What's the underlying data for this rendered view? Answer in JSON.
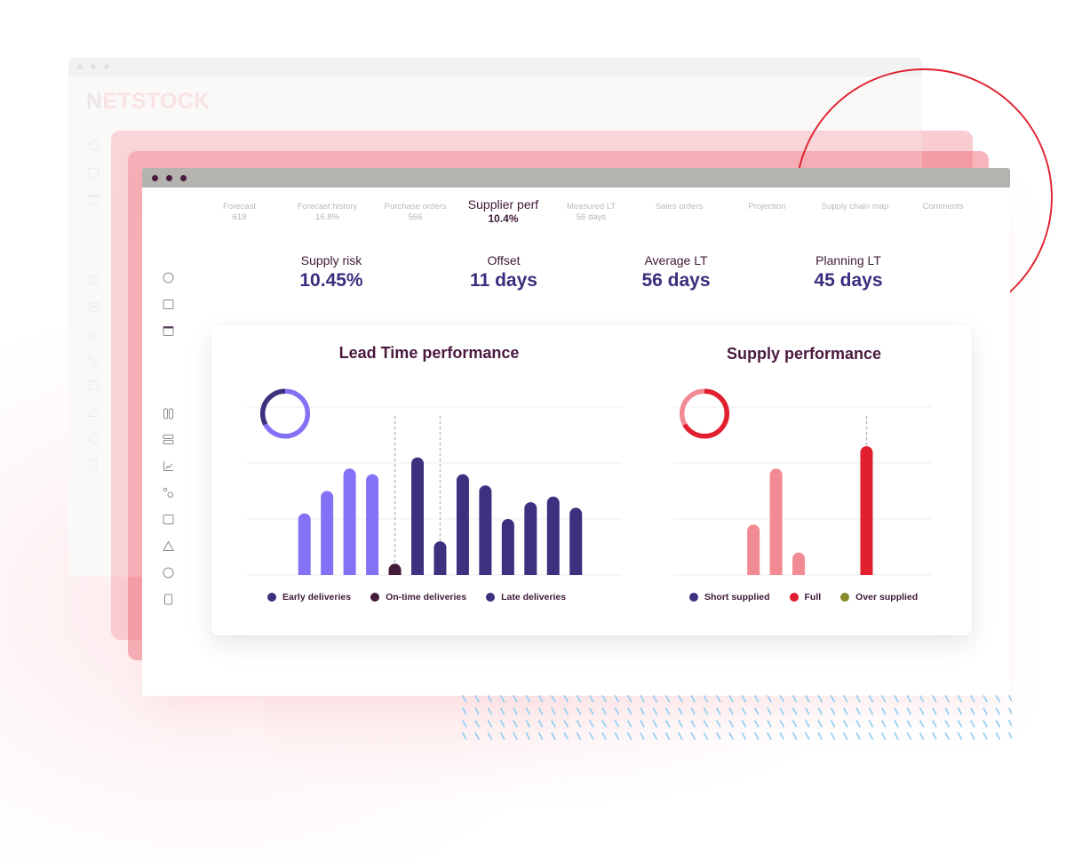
{
  "background_window": {
    "logo_initial": "N",
    "logo_rest": "ETSTOCK",
    "sidebar_icons": [
      "circle",
      "square",
      "calendar",
      "columns",
      "rows",
      "line-chart",
      "scatter",
      "square",
      "triangle",
      "circle",
      "rectangle"
    ]
  },
  "main_window": {
    "tabs": [
      {
        "label": "Forecast",
        "value": "619",
        "active": false
      },
      {
        "label": "Forecast history",
        "value": "16.8%",
        "active": false
      },
      {
        "label": "Purchase orders",
        "value": "566",
        "active": false
      },
      {
        "label": "Supplier perf",
        "value": "10.4%",
        "active": true
      },
      {
        "label": "Measured LT",
        "value": "56 days",
        "active": false
      },
      {
        "label": "Sales orders",
        "active": false
      },
      {
        "label": "Projection",
        "active": false
      },
      {
        "label": "Supply chain map",
        "active": false
      },
      {
        "label": "Comments",
        "active": false
      }
    ],
    "kpis": [
      {
        "label": "Supply risk",
        "value": "10.45%"
      },
      {
        "label": "Offset",
        "value": "11 days"
      },
      {
        "label": "Average LT",
        "value": "56 days"
      },
      {
        "label": "Planning LT",
        "value": "45 days"
      }
    ],
    "sidebar_icons": [
      "circle",
      "square",
      "calendar",
      "columns",
      "rows",
      "line-chart",
      "scatter",
      "square",
      "triangle",
      "circle",
      "rectangle"
    ]
  },
  "colors": {
    "brand_red": "#e0202e",
    "title_text": "#4a1a3f",
    "kpi_value": "#3b2d7d",
    "window_titlebar": "#b5b3af",
    "hatch": "#8ecff2"
  },
  "chart_data": [
    {
      "type": "bar",
      "title": "Lead Time performance",
      "xlabel": "",
      "ylabel": "",
      "x": [
        1,
        2,
        3,
        4,
        5,
        6,
        7,
        8,
        9,
        10,
        11,
        12,
        13
      ],
      "ylim": [
        0,
        30
      ],
      "gridlines": [
        0,
        10,
        20,
        30
      ],
      "grid": true,
      "legend": "bottom",
      "series": [
        {
          "name": "Early deliveries",
          "key": "early",
          "bar_color": "#8472f6",
          "legend_color": "#3e2f7f",
          "values": [
            11,
            15,
            19,
            18,
            null,
            null,
            null,
            null,
            null,
            null,
            null,
            null,
            null
          ]
        },
        {
          "name": "On-time deliveries",
          "key": "on-time",
          "bar_color": "#431a3a",
          "legend_color": "#431a3a",
          "values": [
            null,
            null,
            null,
            null,
            2,
            null,
            null,
            null,
            null,
            null,
            null,
            null,
            null
          ]
        },
        {
          "name": "Late deliveries",
          "key": "late",
          "bar_color": "#3e2f7f",
          "legend_color": "#3e2f7f",
          "values": [
            null,
            null,
            null,
            null,
            null,
            21,
            6,
            18,
            16,
            10,
            13,
            14,
            12
          ]
        }
      ],
      "reference_lines": [
        {
          "x": 5
        },
        {
          "x": 7
        }
      ],
      "donut": [
        {
          "value": 67,
          "color": "#8472f6"
        },
        {
          "value": 33,
          "color": "#3e2f7f"
        }
      ]
    },
    {
      "type": "bar",
      "title": "Supply performance",
      "xlabel": "",
      "ylabel": "",
      "x": [
        1,
        2,
        3,
        4,
        5,
        6,
        7,
        8,
        9
      ],
      "ylim": [
        0,
        30
      ],
      "gridlines": [
        0,
        10,
        20,
        30
      ],
      "grid": true,
      "legend": "bottom",
      "series": [
        {
          "name": "Short supplied",
          "key": "short-supplied",
          "bar_color": "#f28a93",
          "legend_color": "#3e2f7f",
          "values": [
            null,
            9,
            19,
            4,
            null,
            null,
            null,
            null,
            null
          ]
        },
        {
          "name": "Full",
          "key": "full",
          "bar_color": "#e11f2f",
          "legend_color": "#e21f30",
          "values": [
            null,
            null,
            null,
            null,
            null,
            null,
            23,
            null,
            null
          ]
        },
        {
          "name": "Over supplied",
          "key": "over-supplied",
          "bar_color": "#8b8a2d",
          "legend_color": "#8b8a2d",
          "values": [
            null,
            null,
            null,
            null,
            null,
            null,
            null,
            null,
            null
          ]
        }
      ],
      "reference_lines": [
        {
          "x": 7
        }
      ],
      "donut": [
        {
          "value": 67,
          "color": "#e11f2f"
        },
        {
          "value": 33,
          "color": "#f28a93"
        }
      ]
    }
  ]
}
